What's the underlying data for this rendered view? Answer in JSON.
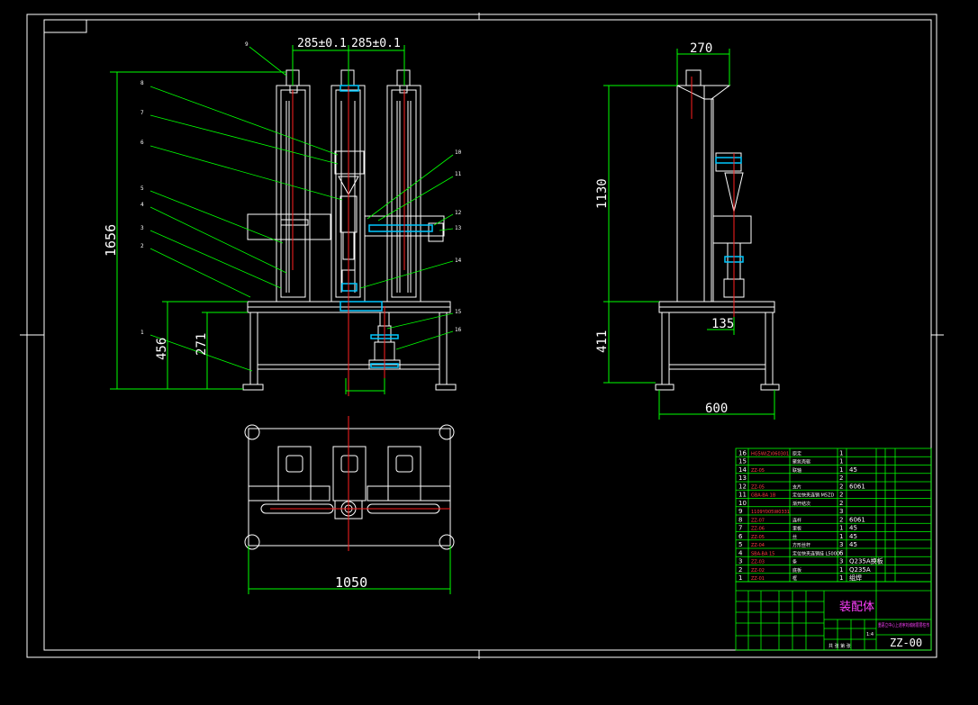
{
  "colors": {
    "background": "#000000",
    "frame": "#ffffff",
    "machine": "#ffffff",
    "dimension": "#00ff00",
    "center_line": "#ff2020",
    "component_blue": "#00c8ff",
    "leader": "#00ff00",
    "title_red": "#ff4040",
    "title_magenta": "#ff40ff"
  },
  "front_view": {
    "dims": {
      "top_left": "285±0.1",
      "top_right": "285±0.1",
      "height_total": "1656",
      "height_base": "456",
      "height_table": "271"
    },
    "balloons": [
      "1",
      "2",
      "3",
      "4",
      "5",
      "6",
      "7",
      "8",
      "9",
      "10",
      "11",
      "12",
      "13",
      "14",
      "15",
      "16"
    ]
  },
  "side_view": {
    "dims": {
      "top": "270",
      "height_upper": "1130",
      "height_lower": "411",
      "offset": "135",
      "width": "600"
    }
  },
  "top_view": {
    "dims": {
      "width": "1050"
    }
  },
  "bom": {
    "rows": [
      {
        "no": "16",
        "code": "HG5W(Z)060301",
        "name": "原定",
        "qty": "1",
        "mat": ""
      },
      {
        "no": "15",
        "code": "",
        "name": "聚氮壳驱",
        "qty": "1",
        "mat": ""
      },
      {
        "no": "14",
        "code": "ZZ-05",
        "name": "联轴",
        "qty": "1",
        "mat": "45"
      },
      {
        "no": "13",
        "code": "",
        "name": "",
        "qty": "2",
        "mat": ""
      },
      {
        "no": "12",
        "code": "ZZ-05",
        "name": "支片",
        "qty": "2",
        "mat": "6061"
      },
      {
        "no": "11",
        "code": "GBA-BA 1B",
        "name": "定位快夹连销 M5ZD",
        "qty": "2",
        "mat": ""
      },
      {
        "no": "10",
        "code": "",
        "name": "渐开结次",
        "qty": "2",
        "mat": ""
      },
      {
        "no": "9",
        "code": "1109Y005W0331",
        "name": "",
        "qty": "3",
        "mat": ""
      },
      {
        "no": "8",
        "code": "ZZ-07",
        "name": "连杆",
        "qty": "2",
        "mat": "6061"
      },
      {
        "no": "7",
        "code": "ZZ-06",
        "name": "里板",
        "qty": "1",
        "mat": "45"
      },
      {
        "no": "6",
        "code": "ZZ-05",
        "name": "丝",
        "qty": "1",
        "mat": "45"
      },
      {
        "no": "5",
        "code": "ZZ-04",
        "name": "方形丝杆",
        "qty": "3",
        "mat": "45"
      },
      {
        "no": "4",
        "code": "SBA-BA 15",
        "name": "定位快夹连销挂 L500D",
        "qty": "6",
        "mat": ""
      },
      {
        "no": "3",
        "code": "ZZ-03",
        "name": "条",
        "qty": "3",
        "mat": "Q235A换板"
      },
      {
        "no": "2",
        "code": "ZZ-02",
        "name": "底板",
        "qty": "1",
        "mat": "Q235A"
      },
      {
        "no": "1",
        "code": "ZZ-01",
        "name": "框",
        "qty": "1",
        "mat": "组焊"
      }
    ]
  },
  "title_block": {
    "title": "装配体",
    "drawing_no": "ZZ-00",
    "company": "重恶立中心上述序刘城房层层柱市",
    "scale": "1:4",
    "sheet": "共 张 第 张"
  }
}
